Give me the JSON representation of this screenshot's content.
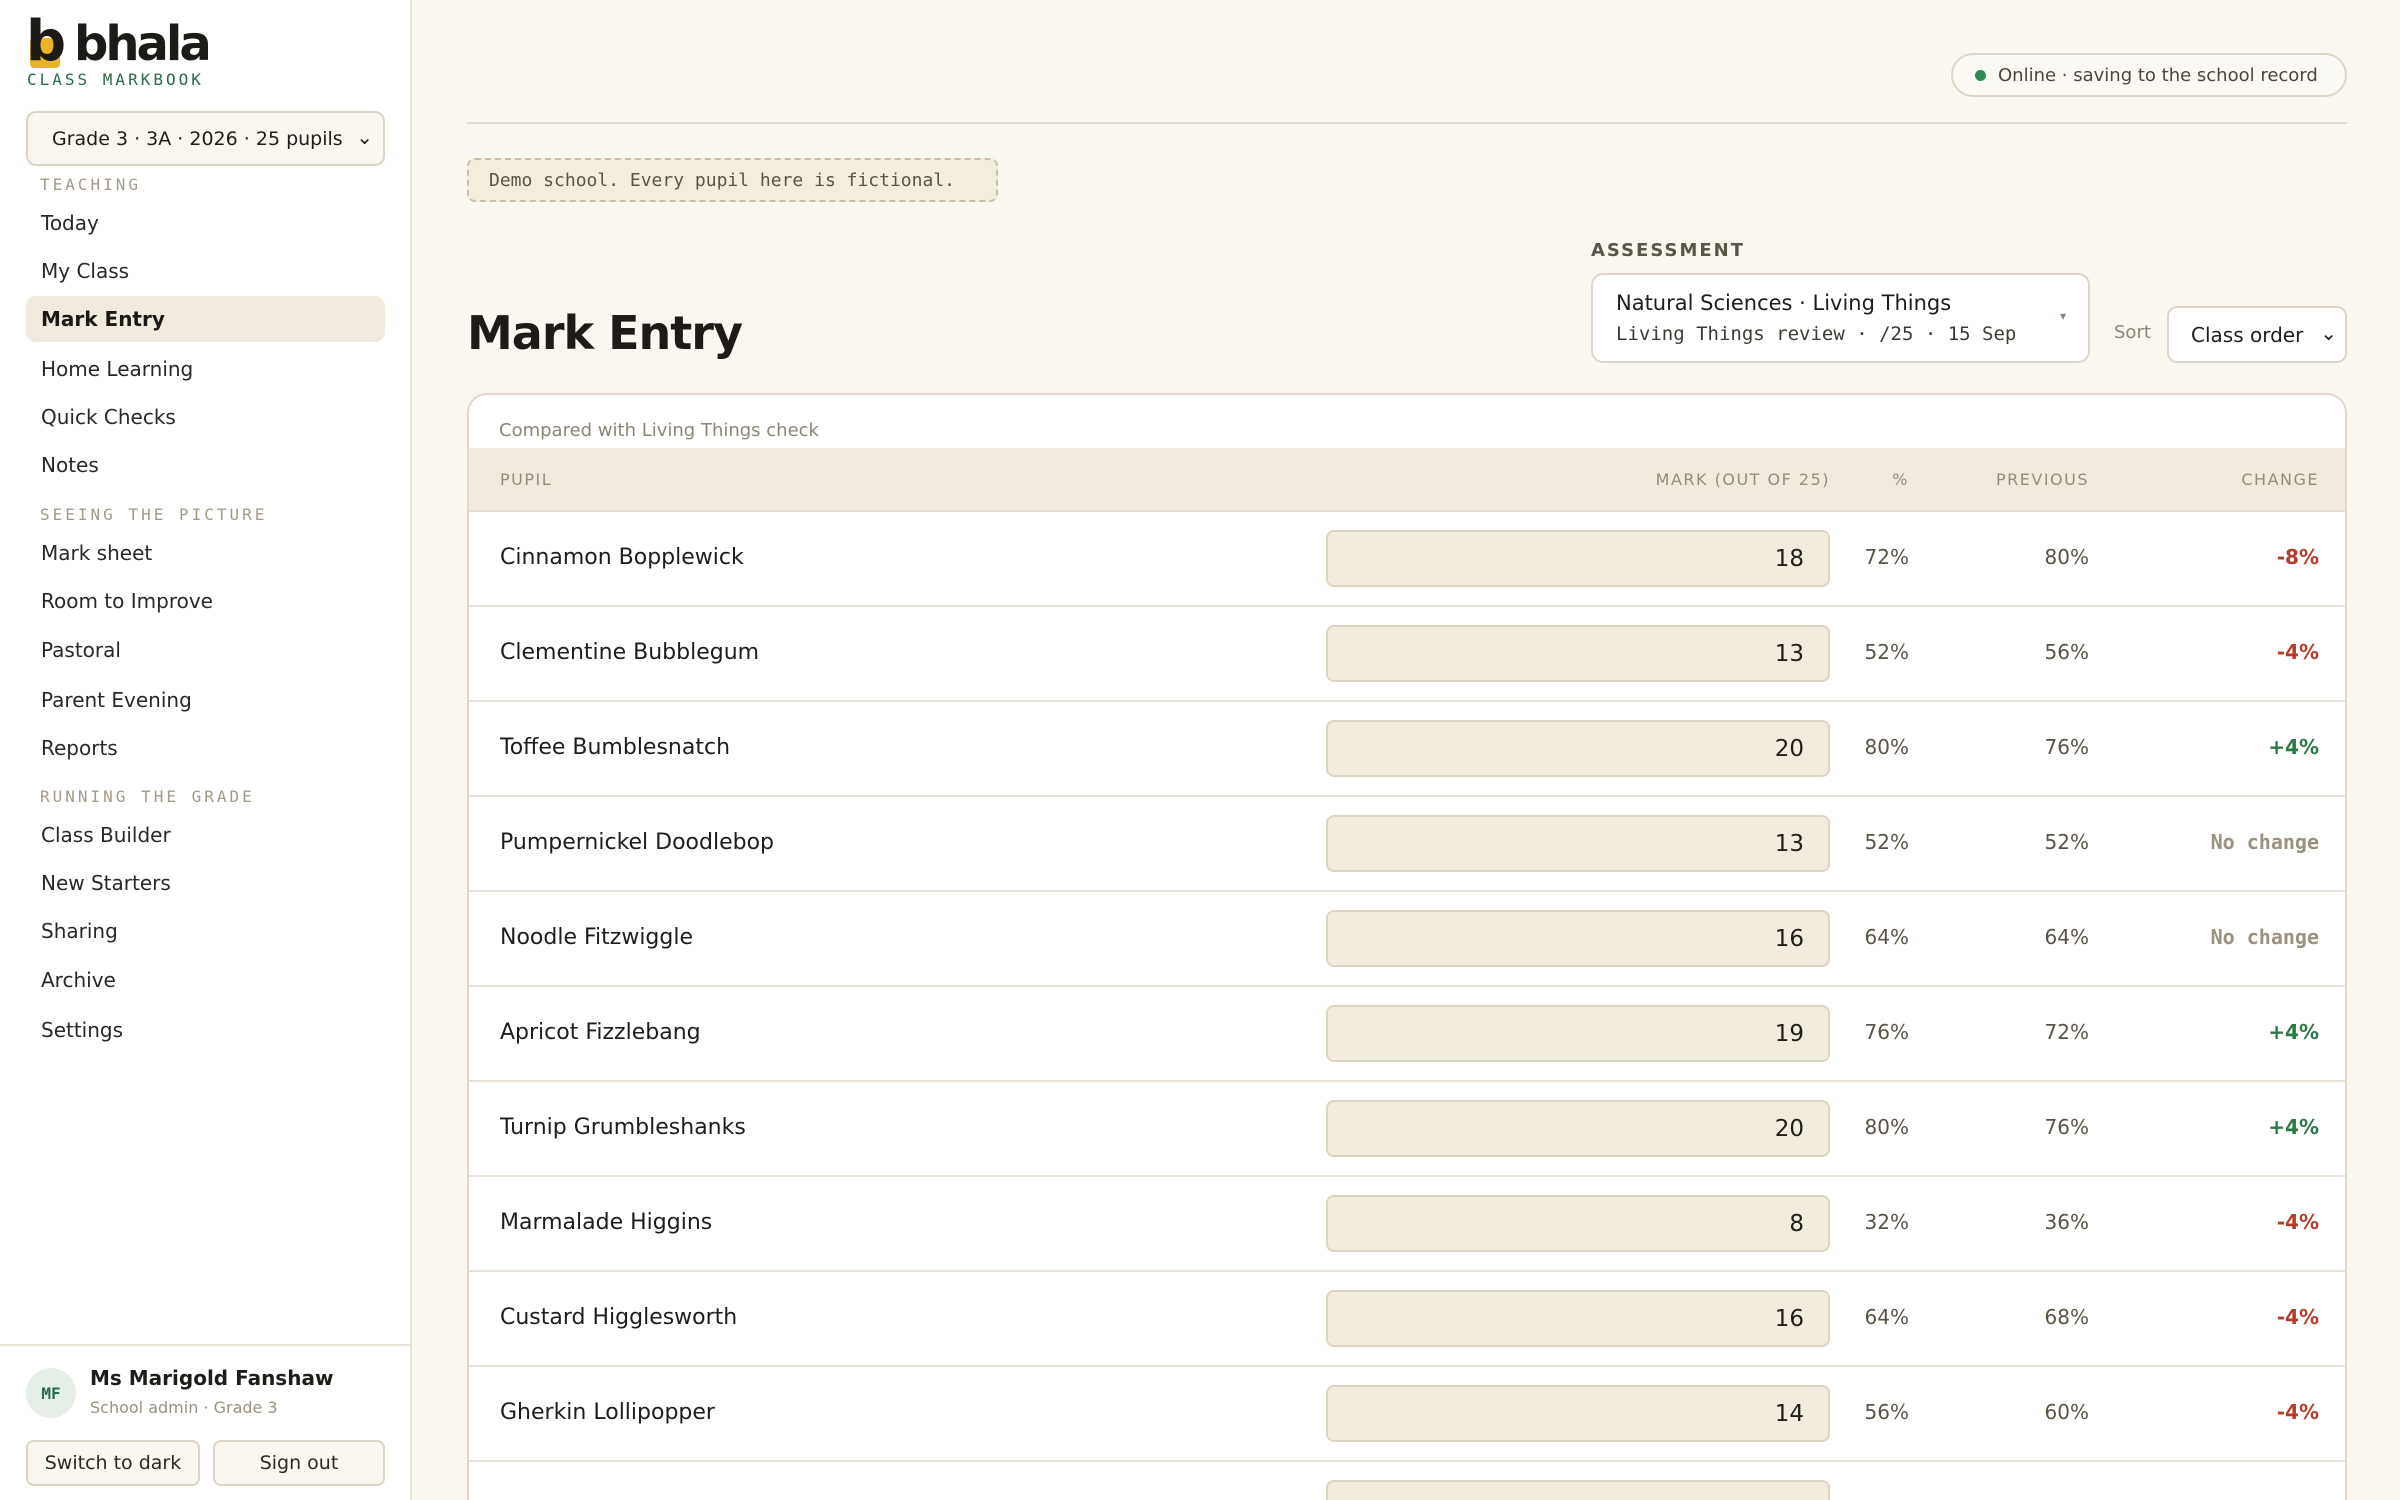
{
  "brand": {
    "name": "bhala",
    "letter": "b",
    "subtitle": "CLASS MARKBOOK",
    "accent": "#e8b42a"
  },
  "class_selector": {
    "value": "Grade 3 · 3A · 2026 · 25 pupils"
  },
  "nav": {
    "sections": [
      {
        "title": "TEACHING",
        "items": [
          "Today",
          "My Class",
          "Mark Entry",
          "Home Learning",
          "Quick Checks",
          "Notes"
        ]
      },
      {
        "title": "SEEING THE PICTURE",
        "items": [
          "Mark sheet",
          "Room to Improve",
          "Pastoral",
          "Parent Evening",
          "Reports"
        ]
      },
      {
        "title": "RUNNING THE GRADE",
        "items": [
          "Class Builder",
          "New Starters",
          "Sharing",
          "Archive",
          "Settings"
        ]
      }
    ],
    "active": "Mark Entry"
  },
  "user": {
    "initials": "MF",
    "name": "Ms Marigold Fanshaw",
    "role": "School admin · Grade 3",
    "theme_button": "Switch to dark",
    "signout_button": "Sign out"
  },
  "status": {
    "text": "Online · saving to the school record",
    "color": "#2e8a54"
  },
  "demo_note": "Demo school. Every pupil here is fictional.",
  "page_title": "Mark Entry",
  "assessment": {
    "label": "ASSESSMENT",
    "title": "Natural Sciences · Living Things",
    "subtitle": "Living Things review · /25 · 15 Sep"
  },
  "sort": {
    "label": "Sort",
    "value": "Class order"
  },
  "table": {
    "compared_text": "Compared with Living Things check",
    "headers": {
      "pupil": "PUPIL",
      "mark": "MARK (OUT OF 25)",
      "pct": "%",
      "previous": "PREVIOUS",
      "change": "CHANGE"
    },
    "rows": [
      {
        "name": "Cinnamon Bopplewick",
        "mark": "18",
        "pct": "72%",
        "previous": "80%",
        "change": "-8%",
        "trend": "neg"
      },
      {
        "name": "Clementine Bubblegum",
        "mark": "13",
        "pct": "52%",
        "previous": "56%",
        "change": "-4%",
        "trend": "neg"
      },
      {
        "name": "Toffee Bumblesnatch",
        "mark": "20",
        "pct": "80%",
        "previous": "76%",
        "change": "+4%",
        "trend": "pos"
      },
      {
        "name": "Pumpernickel Doodlebop",
        "mark": "13",
        "pct": "52%",
        "previous": "52%",
        "change": "No change",
        "trend": "none"
      },
      {
        "name": "Noodle Fitzwiggle",
        "mark": "16",
        "pct": "64%",
        "previous": "64%",
        "change": "No change",
        "trend": "none"
      },
      {
        "name": "Apricot Fizzlebang",
        "mark": "19",
        "pct": "76%",
        "previous": "72%",
        "change": "+4%",
        "trend": "pos"
      },
      {
        "name": "Turnip Grumbleshanks",
        "mark": "20",
        "pct": "80%",
        "previous": "76%",
        "change": "+4%",
        "trend": "pos"
      },
      {
        "name": "Marmalade Higgins",
        "mark": "8",
        "pct": "32%",
        "previous": "36%",
        "change": "-4%",
        "trend": "neg"
      },
      {
        "name": "Custard Higglesworth",
        "mark": "16",
        "pct": "64%",
        "previous": "68%",
        "change": "-4%",
        "trend": "neg"
      },
      {
        "name": "Gherkin Lollipopper",
        "mark": "14",
        "pct": "56%",
        "previous": "60%",
        "change": "-4%",
        "trend": "neg"
      }
    ]
  }
}
